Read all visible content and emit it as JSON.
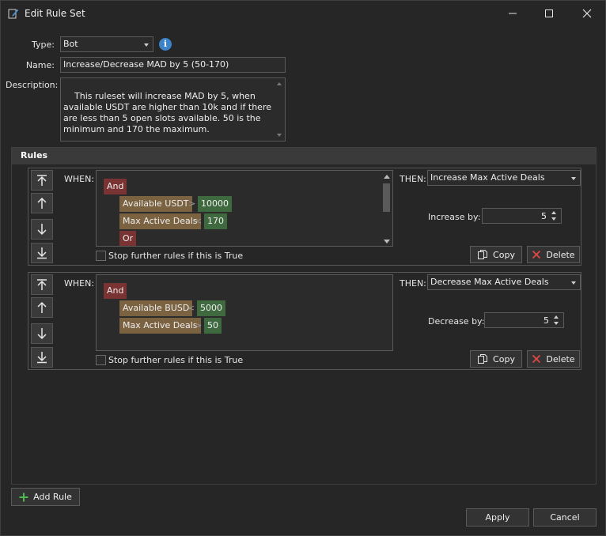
{
  "window": {
    "title": "Edit Rule Set",
    "icon": "edit-document-icon"
  },
  "form": {
    "type_label": "Type:",
    "type_value": "Bot",
    "name_label": "Name:",
    "name_value": "Increase/Decrease MAD by 5 (50-170)",
    "description_label": "Description:",
    "description_value": "This ruleset will increase MAD by 5, when available USDT are higher than 10k and if there are less than 5 open slots available. 50 is the minimum and 170 the maximum."
  },
  "rules": {
    "title": "Rules",
    "when_label": "WHEN:",
    "then_label": "THEN:",
    "stop_label": "Stop further rules if this is True",
    "copy_label": "Copy",
    "delete_label": "Delete",
    "items": [
      {
        "conditions": {
          "group": "And",
          "rows": [
            {
              "variable": "Available USDT",
              "operator": ">",
              "value": "10000"
            },
            {
              "variable": "Max Active Deals",
              "operator": "<",
              "value": "170"
            }
          ],
          "next_group": "Or"
        },
        "action": "Increase Max Active Deals",
        "by_label": "Increase by:",
        "by_value": "5",
        "stop_checked": false
      },
      {
        "conditions": {
          "group": "And",
          "rows": [
            {
              "variable": "Available BUSD",
              "operator": "<",
              "value": "5000"
            },
            {
              "variable": "Max Active Deals",
              "operator": ">",
              "value": "50"
            }
          ]
        },
        "action": "Decrease Max Active Deals",
        "by_label": "Decrease by:",
        "by_value": "5",
        "stop_checked": false
      }
    ]
  },
  "footer": {
    "add_rule_label": "Add Rule",
    "apply_label": "Apply",
    "cancel_label": "Cancel"
  },
  "colors": {
    "background": "#262626",
    "info_icon": "#3c83c9",
    "group_token": "#7a3333",
    "variable_token": "#7b6241",
    "value_token": "#3f6a3f",
    "delete_red": "#e04848",
    "add_green": "#4fb84f"
  }
}
